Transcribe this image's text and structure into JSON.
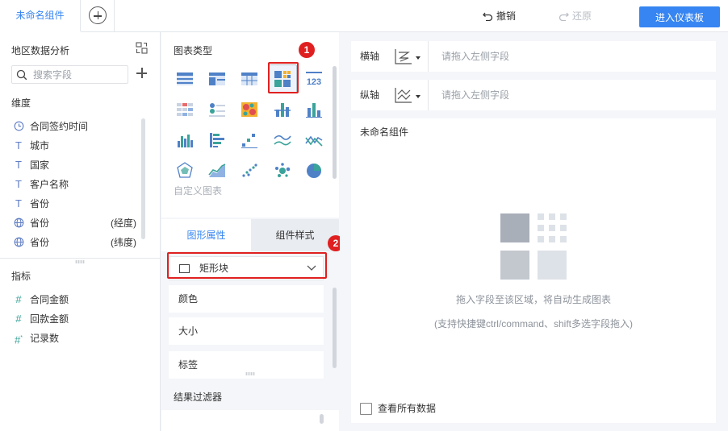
{
  "topbar": {
    "tab_name": "未命名组件",
    "undo_label": "撤销",
    "redo_label": "还原",
    "enter_dashboard_label": "进入仪表板"
  },
  "left_panel": {
    "dataset_title": "地区数据分析",
    "search_placeholder": "搜索字段",
    "dimension_label": "维度",
    "dimensions": [
      {
        "icon": "clock-icon",
        "label": "合同签约时间",
        "suffix": ""
      },
      {
        "icon": "text-t-icon",
        "label": "城市",
        "suffix": ""
      },
      {
        "icon": "text-t-icon",
        "label": "国家",
        "suffix": ""
      },
      {
        "icon": "text-t-icon",
        "label": "客户名称",
        "suffix": ""
      },
      {
        "icon": "text-t-icon",
        "label": "省份",
        "suffix": ""
      },
      {
        "icon": "globe-icon",
        "label": "省份",
        "suffix": "(经度)"
      },
      {
        "icon": "globe-icon",
        "label": "省份",
        "suffix": "(纬度)"
      }
    ],
    "indicator_label": "指标",
    "indicators": [
      {
        "icon": "hash-icon",
        "label": "合同金额"
      },
      {
        "icon": "hash-icon",
        "label": "回款金额"
      },
      {
        "icon": "hash-record-icon",
        "label": "记录数"
      }
    ]
  },
  "middle_panel": {
    "chart_type_title": "图表类型",
    "custom_chart_label": "自定义图表",
    "selected_chart_type": "rectangle-block-chart-icon",
    "tab_graphic_props": "图形属性",
    "tab_component_style": "组件样式",
    "shape_selected": "矩形块",
    "prop_items": [
      "颜色",
      "大小",
      "标签"
    ],
    "result_filter_title": "结果过滤器",
    "accent_color": "#3685f2",
    "callout_color": "#e02020",
    "callout_1": "1",
    "callout_2": "2"
  },
  "right_panel": {
    "x_axis_label": "横轴",
    "y_axis_label": "纵轴",
    "axis_placeholder": "请拖入左侧字段",
    "canvas_title": "未命名组件",
    "hint_main": "拖入字段至该区域，将自动生成图表",
    "hint_sub": "(支持快捷键ctrl/command、shift多选字段拖入)",
    "view_all_label": "查看所有数据"
  }
}
